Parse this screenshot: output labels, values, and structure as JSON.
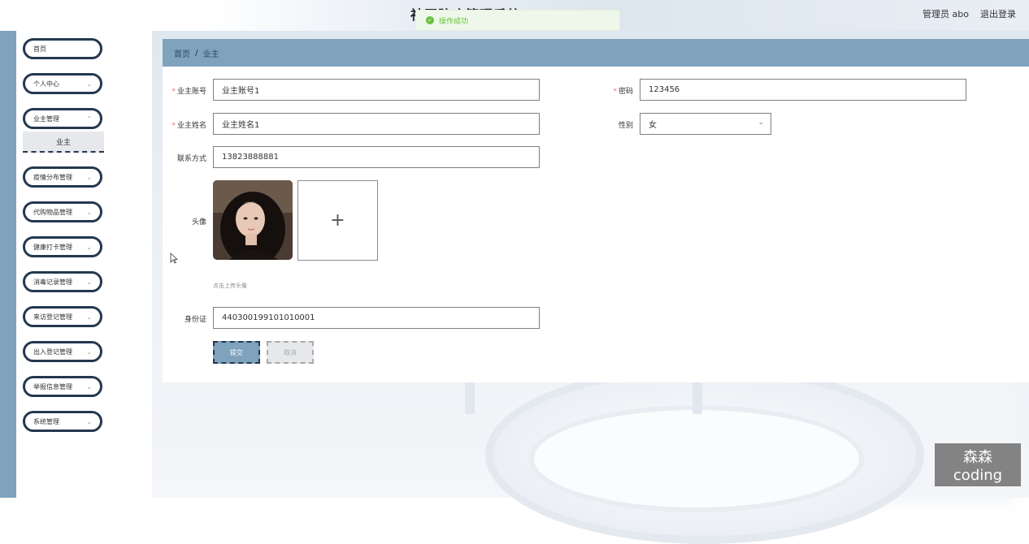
{
  "header": {
    "title": "社区防疫管理系统",
    "user_role_name": "管理员 abo",
    "logout_label": "退出登录"
  },
  "toast": {
    "message": "操作成功"
  },
  "sidebar": {
    "items": [
      {
        "label": "首页"
      },
      {
        "label": "个人中心"
      },
      {
        "label": "业主管理"
      },
      {
        "label": "疫情分布管理"
      },
      {
        "label": "代购物品管理"
      },
      {
        "label": "健康打卡管理"
      },
      {
        "label": "消毒记录管理"
      },
      {
        "label": "来访登记管理"
      },
      {
        "label": "出入登记管理"
      },
      {
        "label": "举报信息管理"
      },
      {
        "label": "系统管理"
      }
    ],
    "submenu_label": "业主"
  },
  "breadcrumb": {
    "home": "首页",
    "separator": "/",
    "current": "业主"
  },
  "form": {
    "account": {
      "label": "业主账号",
      "value": "业主账号1"
    },
    "password": {
      "label": "密码",
      "value": "123456"
    },
    "name": {
      "label": "业主姓名",
      "value": "业主姓名1"
    },
    "gender": {
      "label": "性别",
      "value": "女"
    },
    "phone": {
      "label": "联系方式",
      "value": "13823888881"
    },
    "avatar": {
      "label": "头像",
      "hint": "点击上传头像"
    },
    "id_card": {
      "label": "身份证",
      "value": "440300199101010001"
    },
    "submit_label": "提交",
    "cancel_label": "取消"
  },
  "watermark": "森森coding",
  "colors": {
    "accent": "#7fa2bd",
    "dark": "#24384f",
    "success": "#67c23a",
    "required": "#f56c6c"
  }
}
